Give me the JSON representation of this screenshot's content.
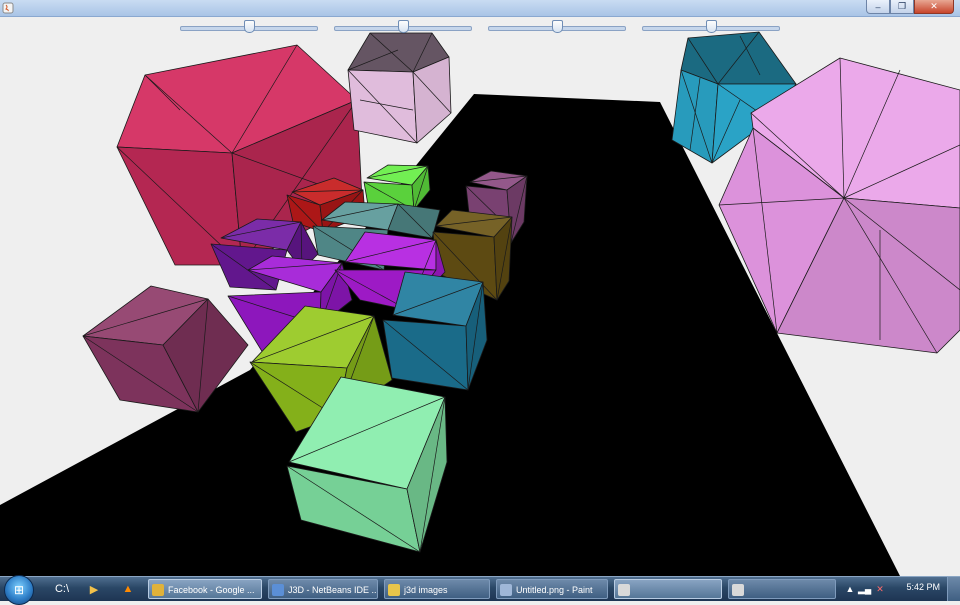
{
  "window": {
    "title": "",
    "controls": {
      "minimize": "–",
      "maximize": "❐",
      "close": "✕"
    }
  },
  "sliders": [
    {
      "name": "slider-1",
      "value": 0.5
    },
    {
      "name": "slider-2",
      "value": 0.5
    },
    {
      "name": "slider-3",
      "value": 0.5
    },
    {
      "name": "slider-4",
      "value": 0.5
    }
  ],
  "scene": {
    "background": "#efefef",
    "floor_color": "#000000",
    "shape_edge_color": "#1a1a1a",
    "shapes": [
      {
        "name": "shape-crimson-large",
        "color": "#d42e60"
      },
      {
        "name": "shape-lavender",
        "color": "#e0bcdc"
      },
      {
        "name": "shape-cyan",
        "color": "#2aa3c6"
      },
      {
        "name": "shape-pink-large",
        "color": "#e89ae6"
      },
      {
        "name": "cube-red",
        "color": "#c41a1a"
      },
      {
        "name": "cube-green",
        "color": "#66ee44"
      },
      {
        "name": "cube-mauve",
        "color": "#8a4a80"
      },
      {
        "name": "cube-teal-gray",
        "color": "#5a9898"
      },
      {
        "name": "cube-purple",
        "color": "#6f1aa0"
      },
      {
        "name": "cube-olive",
        "color": "#6a5414"
      },
      {
        "name": "cube-violet-1",
        "color": "#a01ad6"
      },
      {
        "name": "cube-violet-2",
        "color": "#b21ee0"
      },
      {
        "name": "cube-steel-blue",
        "color": "#1e7a9c"
      },
      {
        "name": "cube-plum",
        "color": "#8e3a68"
      },
      {
        "name": "cube-lime",
        "color": "#96c81e"
      },
      {
        "name": "cube-mint",
        "color": "#86ecaa"
      }
    ]
  },
  "taskbar": {
    "start_label": "",
    "quicklaunch": [
      {
        "name": "cmd-icon",
        "glyph": "C:\\"
      },
      {
        "name": "media-player-icon",
        "glyph": "▶"
      },
      {
        "name": "vlc-icon",
        "glyph": "▲"
      }
    ],
    "tasks": [
      {
        "label": "Facebook - Google ...",
        "icon_color": "#e0b23a",
        "icon": "chrome-icon"
      },
      {
        "label": "J3D - NetBeans IDE ...",
        "icon_color": "#5b8fd6",
        "icon": "netbeans-icon"
      },
      {
        "label": "j3d images",
        "icon_color": "#e8c54a",
        "icon": "folder-icon"
      },
      {
        "label": "Untitled.png - Paint",
        "icon_color": "#9fb7d8",
        "icon": "paint-icon"
      },
      {
        "label": "",
        "icon_color": "#d9d9d9",
        "icon": "java-icon"
      },
      {
        "label": "",
        "icon_color": "#d9d9d9",
        "icon": "java-icon"
      }
    ],
    "tray": {
      "clock": "5:42 PM"
    }
  }
}
